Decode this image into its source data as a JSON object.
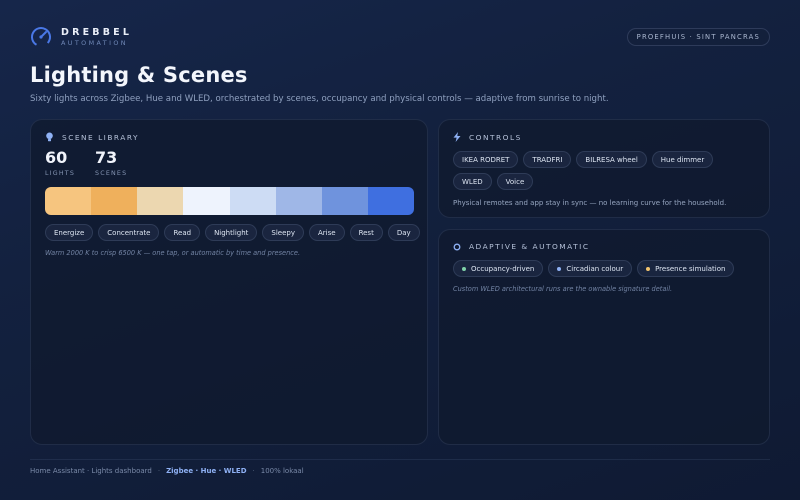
{
  "brand": {
    "name": "DREBBEL",
    "sub": "AUTOMATION",
    "logo_icon": "gauge-dial-icon"
  },
  "location": "PROEFHUIS · SINT PANCRAS",
  "page": {
    "title": "Lighting & Scenes",
    "subtitle": "Sixty lights across Zigbee, Hue and WLED, orchestrated by scenes, occupancy and physical controls — adaptive from sunrise to night."
  },
  "scene_library": {
    "title": "SCENE LIBRARY",
    "icon": "bulb-icon",
    "stats": [
      {
        "value": "60",
        "label": "LIGHTS"
      },
      {
        "value": "73",
        "label": "SCENES"
      }
    ],
    "swatches": [
      "#f6c57f",
      "#efb05c",
      "#ecd7b0",
      "#eef3fd",
      "#cddcf4",
      "#9fb7e7",
      "#6f93dd",
      "#3f6fe0"
    ],
    "scenes": [
      "Energize",
      "Concentrate",
      "Read",
      "Nightlight",
      "Sleepy",
      "Arise",
      "Rest",
      "Day"
    ],
    "caption": "Warm 2000 K to crisp 6500 K — one tap, or automatic by time and presence."
  },
  "controls": {
    "title": "CONTROLS",
    "icon": "lightning-icon",
    "items": [
      "IKEA RODRET",
      "TRADFRI",
      "BILRESA wheel",
      "Hue dimmer",
      "WLED",
      "Voice"
    ],
    "note": "Physical remotes and app stay in sync — no learning curve for the household."
  },
  "adaptive": {
    "title": "ADAPTIVE & AUTOMATIC",
    "icon": "ring-icon",
    "items": [
      {
        "label": "Occupancy-driven",
        "dot_color": "#7fd1a8"
      },
      {
        "label": "Circadian colour",
        "dot_color": "#8fb1f4"
      },
      {
        "label": "Presence simulation",
        "dot_color": "#f2c46e"
      }
    ],
    "note": "Custom WLED architectural runs are the ownable signature detail."
  },
  "footer": {
    "left": "Home Assistant · Lights dashboard",
    "sep": "·",
    "highlight": "Zigbee · Hue · WLED",
    "right": "100% lokaal"
  },
  "colors": {
    "accent": "#4a78e6",
    "background": "#13213f"
  }
}
